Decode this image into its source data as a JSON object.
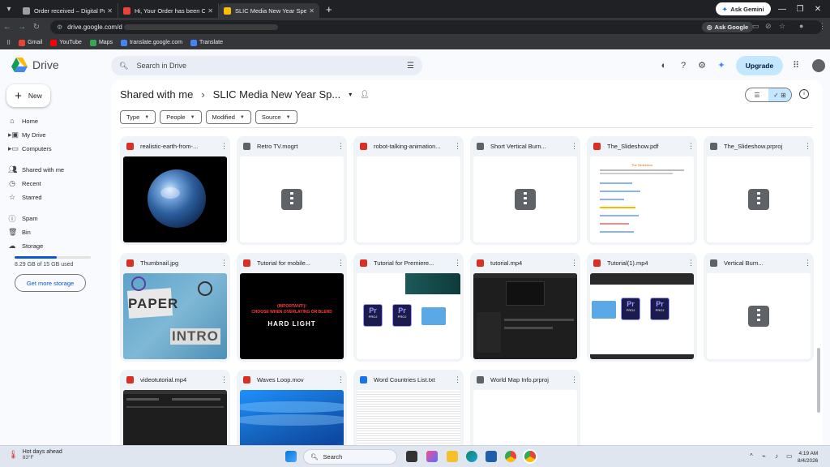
{
  "browser": {
    "tabs": [
      {
        "title": "Order received – Digital Produ",
        "color": "#9aa0a6"
      },
      {
        "title": "Hi, Your Order has been Comp",
        "color": "#ea4335"
      },
      {
        "title": "SLIC Media New Year Special P",
        "color": "#fbbc04"
      }
    ],
    "ask_gemini": "Ask Gemini",
    "url": "drive.google.com/d",
    "ask_google": "Ask Google",
    "bookmarks": [
      {
        "label": "Gmail",
        "color": "#ea4335"
      },
      {
        "label": "YouTube",
        "color": "#ff0000"
      },
      {
        "label": "Maps",
        "color": "#34a853"
      },
      {
        "label": "translate.google.com",
        "color": "#4285f4"
      },
      {
        "label": "Translate",
        "color": "#4285f4"
      }
    ]
  },
  "drive": {
    "app_name": "Drive",
    "search_placeholder": "Search in Drive",
    "upgrade_label": "Upgrade",
    "new_label": "New",
    "nav": {
      "home": "Home",
      "my_drive": "My Drive",
      "computers": "Computers",
      "shared": "Shared with me",
      "recent": "Recent",
      "starred": "Starred",
      "spam": "Spam",
      "bin": "Bin",
      "storage": "Storage"
    },
    "storage_text": "8.29 GB of 15 GB used",
    "storage_fraction": 0.553,
    "get_storage": "Get more storage",
    "breadcrumb": {
      "root": "Shared with me",
      "current": "SLIC Media New Year Sp..."
    },
    "filters": {
      "type": "Type",
      "people": "People",
      "modified": "Modified",
      "source": "Source"
    },
    "files": [
      {
        "name": "realistic-earth-from-...",
        "icon_color": "#d93025"
      },
      {
        "name": "Retro TV.mogrt",
        "icon_color": "#5f6368"
      },
      {
        "name": "robot-talking-animation...",
        "icon_color": "#d93025"
      },
      {
        "name": "Short Vertical Burn...",
        "icon_color": "#5f6368"
      },
      {
        "name": "The_Slideshow.pdf",
        "icon_color": "#d93025"
      },
      {
        "name": "The_Slideshow.prproj",
        "icon_color": "#5f6368"
      },
      {
        "name": "Thumbnail.jpg",
        "icon_color": "#d93025"
      },
      {
        "name": "Tutorial for mobile...",
        "icon_color": "#d93025"
      },
      {
        "name": "Tutorial for Premiere...",
        "icon_color": "#d93025"
      },
      {
        "name": "tutorial.mp4",
        "icon_color": "#d93025"
      },
      {
        "name": "Tutorial(1).mp4",
        "icon_color": "#d93025"
      },
      {
        "name": "Vertical Burn...",
        "icon_color": "#5f6368"
      },
      {
        "name": "videotutorial.mp4",
        "icon_color": "#d93025"
      },
      {
        "name": "Waves Loop.mov",
        "icon_color": "#d93025"
      },
      {
        "name": "Word Countries List.txt",
        "icon_color": "#1a73e8"
      },
      {
        "name": "World Map Info.prproj",
        "icon_color": "#5f6368"
      }
    ],
    "thumb_texts": {
      "slideshow_title": "The Slideshow",
      "paper": "PAPER",
      "intro": "INTRO",
      "important": "(IMPORTANT!)!",
      "choose": "CHOOSE WHEN OVERLAYING OR BLEND",
      "hard_light": "HARD LIGHT",
      "proj": "PROJ",
      "pr": "Pr"
    }
  },
  "taskbar": {
    "weather_title": "Hot days ahead",
    "weather_temp": "83°F",
    "search_label": "Search",
    "time": "4:19 AM",
    "date": "8/4/2026"
  }
}
